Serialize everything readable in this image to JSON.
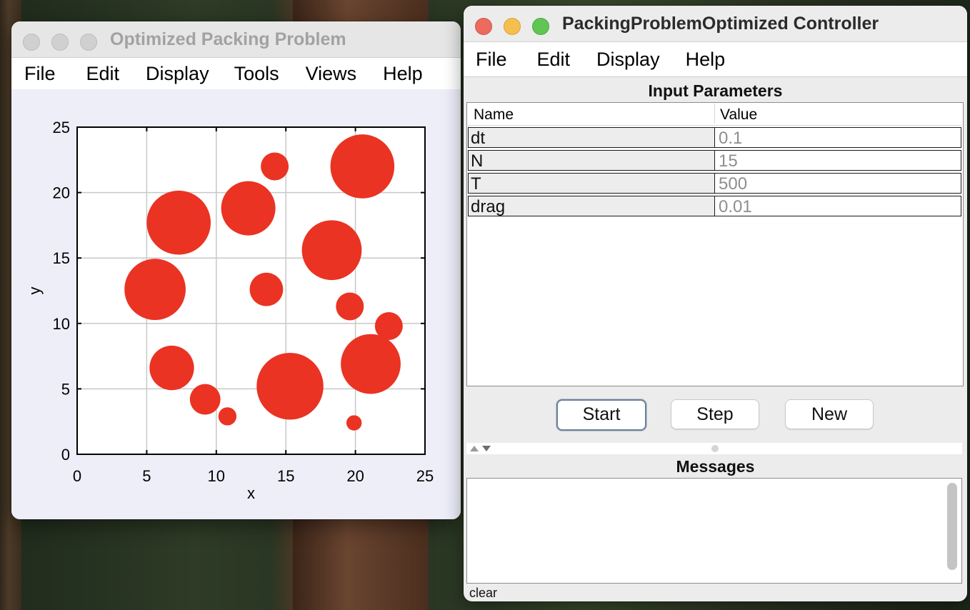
{
  "plot_window": {
    "title": "Optimized Packing Problem",
    "menu": [
      "File",
      "Edit",
      "Display",
      "Tools",
      "Views",
      "Help"
    ]
  },
  "controller_window": {
    "title": "PackingProblemOptimized Controller",
    "menu": [
      "File",
      "Edit",
      "Display",
      "Help"
    ],
    "input_panel_title": "Input Parameters",
    "table_headers": {
      "name": "Name",
      "value": "Value"
    },
    "params": [
      {
        "name": "dt",
        "value": "0.1"
      },
      {
        "name": "N",
        "value": "15"
      },
      {
        "name": "T",
        "value": "500"
      },
      {
        "name": "drag",
        "value": "0.01"
      }
    ],
    "buttons": {
      "start": "Start",
      "step": "Step",
      "new": "New"
    },
    "messages_title": "Messages",
    "status_text": "clear"
  },
  "colors": {
    "circle_fill": "#ea3323",
    "plot_bg": "#eeeef9"
  },
  "chart_data": {
    "type": "scatter",
    "xlabel": "x",
    "ylabel": "y",
    "xlim": [
      0,
      25
    ],
    "ylim": [
      0,
      25
    ],
    "xticks": [
      "0",
      "5",
      "10",
      "15",
      "20",
      "25"
    ],
    "yticks": [
      "0",
      "5",
      "10",
      "15",
      "20",
      "25"
    ],
    "grid": true,
    "points": [
      {
        "x": 20.5,
        "y": 22.0,
        "r": 2.3
      },
      {
        "x": 14.2,
        "y": 22.0,
        "r": 1.0
      },
      {
        "x": 12.3,
        "y": 18.8,
        "r": 1.95
      },
      {
        "x": 7.3,
        "y": 17.7,
        "r": 2.3
      },
      {
        "x": 18.3,
        "y": 15.6,
        "r": 2.15
      },
      {
        "x": 5.6,
        "y": 12.6,
        "r": 2.2
      },
      {
        "x": 13.6,
        "y": 12.6,
        "r": 1.2
      },
      {
        "x": 19.6,
        "y": 11.3,
        "r": 1.0
      },
      {
        "x": 22.4,
        "y": 9.8,
        "r": 1.0
      },
      {
        "x": 21.1,
        "y": 6.9,
        "r": 2.15
      },
      {
        "x": 6.8,
        "y": 6.6,
        "r": 1.6
      },
      {
        "x": 15.3,
        "y": 5.2,
        "r": 2.4
      },
      {
        "x": 9.2,
        "y": 4.2,
        "r": 1.1
      },
      {
        "x": 10.8,
        "y": 2.9,
        "r": 0.65
      },
      {
        "x": 19.9,
        "y": 2.4,
        "r": 0.55
      }
    ]
  }
}
